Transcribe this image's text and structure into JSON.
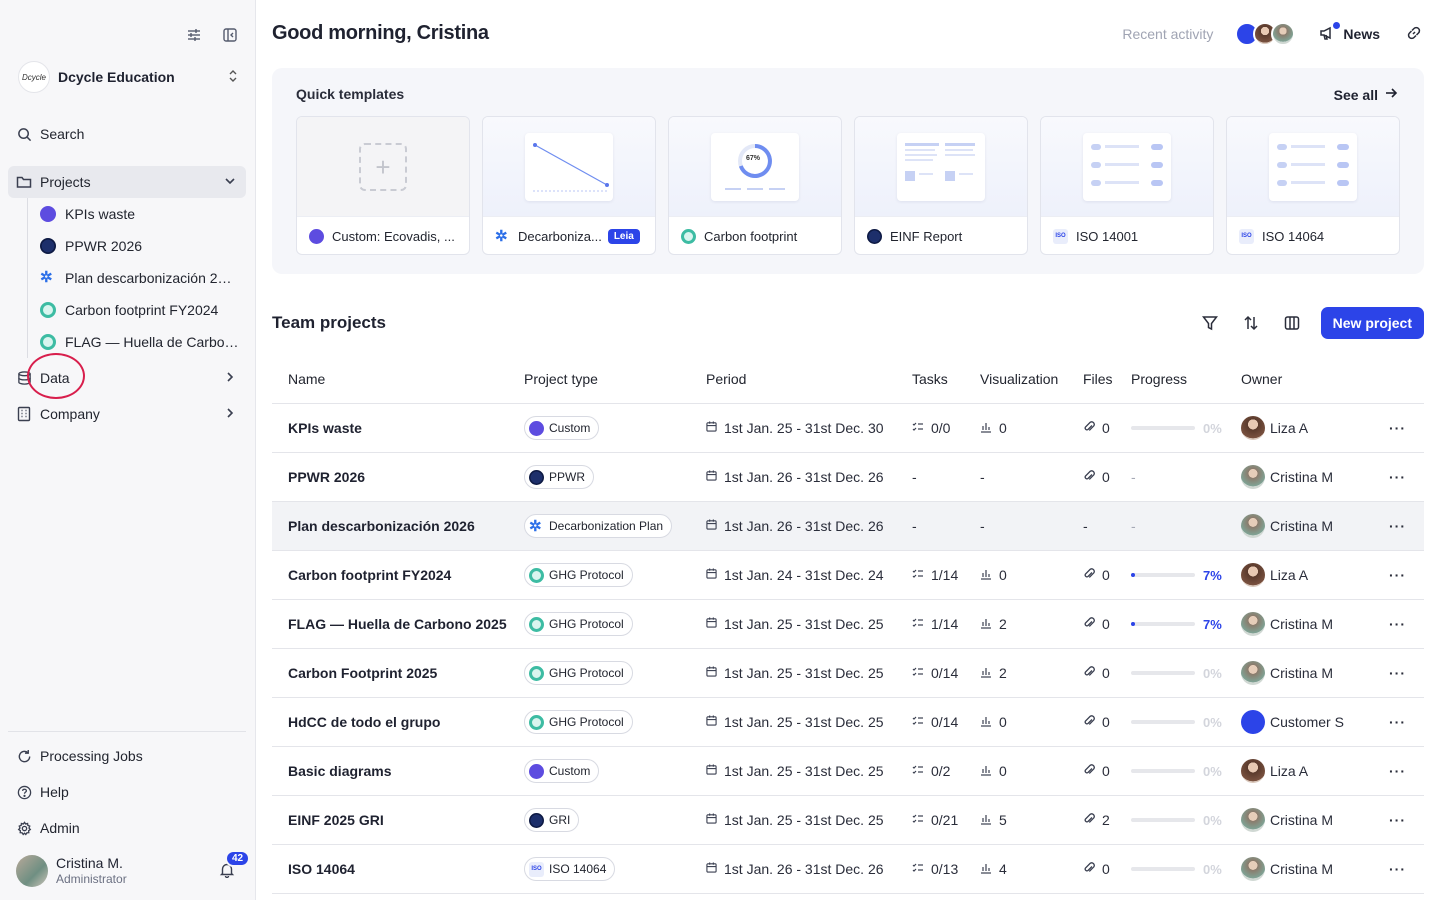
{
  "sidebar": {
    "org_logo_text": "Dcycle",
    "org_name": "Dcycle Education",
    "search_label": "Search",
    "projects_label": "Projects",
    "projects": [
      {
        "label": "KPIs waste",
        "icon": "custom-icon"
      },
      {
        "label": "PPWR 2026",
        "icon": "ppwr-icon"
      },
      {
        "label": "Plan descarbonización 2026",
        "icon": "decarbonization-icon"
      },
      {
        "label": "Carbon footprint FY2024",
        "icon": "ghg-icon"
      },
      {
        "label": "FLAG — Huella de Carbono 2025",
        "icon": "ghg-icon"
      }
    ],
    "data_label": "Data",
    "company_label": "Company",
    "processing_label": "Processing Jobs",
    "help_label": "Help",
    "admin_label": "Admin",
    "user_name": "Cristina M.",
    "user_role": "Administrator",
    "notifications": "42"
  },
  "header": {
    "greeting": "Good morning, Cristina",
    "recent_activity": "Recent activity",
    "news": "News"
  },
  "templates": {
    "title": "Quick templates",
    "see_all": "See all",
    "items": [
      {
        "label": "Custom: Ecovadis, ...",
        "icon": "custom-icon"
      },
      {
        "label": "Decarboniza...",
        "icon": "decarbonization-icon",
        "badge": "Leia"
      },
      {
        "label": "Carbon footprint",
        "icon": "ghg-icon",
        "preview_text": "67%"
      },
      {
        "label": "EINF Report",
        "icon": "ppwr-icon"
      },
      {
        "label": "ISO 14001",
        "icon": "iso-icon"
      },
      {
        "label": "ISO 14064",
        "icon": "iso-icon"
      }
    ]
  },
  "team": {
    "title": "Team projects",
    "new_project": "New project",
    "columns": [
      "Name",
      "Project type",
      "Period",
      "Tasks",
      "Visualization",
      "Files",
      "Progress",
      "Owner"
    ],
    "rows": [
      {
        "name": "KPIs waste",
        "type": "Custom",
        "type_icon": "custom",
        "period": "1st Jan. 25 - 31st Dec. 30",
        "tasks": "0/0",
        "vis": "0",
        "files": "0",
        "progress": "0%",
        "progress_value": 0,
        "owner": "Liza A",
        "owner_av": "liza"
      },
      {
        "name": "PPWR 2026",
        "type": "PPWR",
        "type_icon": "ppwr",
        "period": "1st Jan. 26 - 31st Dec. 26",
        "tasks": "-",
        "vis": "-",
        "files": "0",
        "progress": "-",
        "progress_value": null,
        "owner": "Cristina M",
        "owner_av": "cris"
      },
      {
        "name": "Plan descarbonización 2026",
        "type": "Decarbonization Plan",
        "type_icon": "decarb",
        "period": "1st Jan. 26 - 31st Dec. 26",
        "tasks": "-",
        "vis": "-",
        "files": "-",
        "progress": "-",
        "progress_value": null,
        "owner": "Cristina M",
        "owner_av": "cris"
      },
      {
        "name": "Carbon footprint FY2024",
        "type": "GHG Protocol",
        "type_icon": "ghg",
        "period": "1st Jan. 24 - 31st Dec. 24",
        "tasks": "1/14",
        "vis": "0",
        "files": "0",
        "progress": "7%",
        "progress_value": 7,
        "owner": "Liza A",
        "owner_av": "liza"
      },
      {
        "name": "FLAG — Huella de Carbono 2025",
        "type": "GHG Protocol",
        "type_icon": "ghg",
        "period": "1st Jan. 25 - 31st Dec. 25",
        "tasks": "1/14",
        "vis": "2",
        "files": "0",
        "progress": "7%",
        "progress_value": 7,
        "owner": "Cristina M",
        "owner_av": "cris"
      },
      {
        "name": "Carbon Footprint 2025",
        "type": "GHG Protocol",
        "type_icon": "ghg",
        "period": "1st Jan. 25 - 31st Dec. 25",
        "tasks": "0/14",
        "vis": "2",
        "files": "0",
        "progress": "0%",
        "progress_value": 0,
        "owner": "Cristina M",
        "owner_av": "cris"
      },
      {
        "name": "HdCC de todo el grupo",
        "type": "GHG Protocol",
        "type_icon": "ghg",
        "period": "1st Jan. 25 - 31st Dec. 25",
        "tasks": "0/14",
        "vis": "0",
        "files": "0",
        "progress": "0%",
        "progress_value": 0,
        "owner": "Customer S",
        "owner_av": "cust"
      },
      {
        "name": "Basic diagrams",
        "type": "Custom",
        "type_icon": "custom",
        "period": "1st Jan. 25 - 31st Dec. 25",
        "tasks": "0/2",
        "vis": "0",
        "files": "0",
        "progress": "0%",
        "progress_value": 0,
        "owner": "Liza A",
        "owner_av": "liza"
      },
      {
        "name": "EINF 2025 GRI",
        "type": "GRI",
        "type_icon": "ppwr",
        "period": "1st Jan. 25 - 31st Dec. 25",
        "tasks": "0/21",
        "vis": "5",
        "files": "2",
        "progress": "0%",
        "progress_value": 0,
        "owner": "Cristina M",
        "owner_av": "cris"
      },
      {
        "name": "ISO 14064",
        "type": "ISO 14064",
        "type_icon": "iso",
        "period": "1st Jan. 26 - 31st Dec. 26",
        "tasks": "0/13",
        "vis": "4",
        "files": "0",
        "progress": "0%",
        "progress_value": 0,
        "owner": "Cristina M",
        "owner_av": "cris"
      }
    ],
    "highlighted_row": 2
  },
  "colors": {
    "accent": "#2c44e8",
    "annotation_circle": "#d81e4c"
  }
}
